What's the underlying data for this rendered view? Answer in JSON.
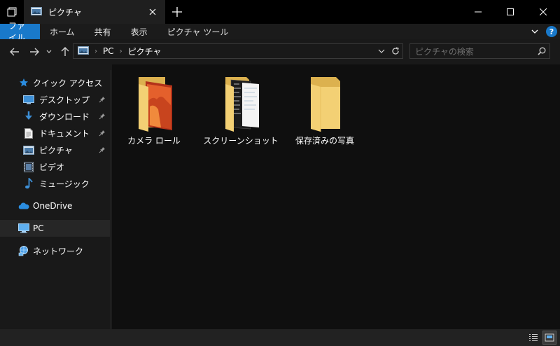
{
  "window": {
    "tab_title": "ピクチャ"
  },
  "ribbon": {
    "tabs": [
      "ファイル",
      "ホーム",
      "共有",
      "表示",
      "ピクチャ ツール"
    ],
    "help": "?"
  },
  "address": {
    "crumbs": [
      "PC",
      "ピクチャ"
    ]
  },
  "search": {
    "placeholder": "ピクチャの検索"
  },
  "navpane": {
    "quick_access": "クイック アクセス",
    "items": [
      {
        "label": "デスクトップ",
        "icon": "desktop-icon",
        "pinned": true
      },
      {
        "label": "ダウンロード",
        "icon": "download-icon",
        "pinned": true
      },
      {
        "label": "ドキュメント",
        "icon": "document-icon",
        "pinned": true
      },
      {
        "label": "ピクチャ",
        "icon": "pictures-icon",
        "pinned": true
      },
      {
        "label": "ビデオ",
        "icon": "video-icon",
        "pinned": false
      },
      {
        "label": "ミュージック",
        "icon": "music-icon",
        "pinned": false
      }
    ],
    "onedrive": "OneDrive",
    "pc": "PC",
    "network": "ネットワーク"
  },
  "folders": [
    {
      "label": "カメラ ロール",
      "thumb": "photo"
    },
    {
      "label": "スクリーンショット",
      "thumb": "screenshot"
    },
    {
      "label": "保存済みの写真",
      "thumb": "empty"
    }
  ],
  "colors": {
    "accent": "#1979ca",
    "folder": "#f3d074",
    "folder_dark": "#dcb14f"
  }
}
